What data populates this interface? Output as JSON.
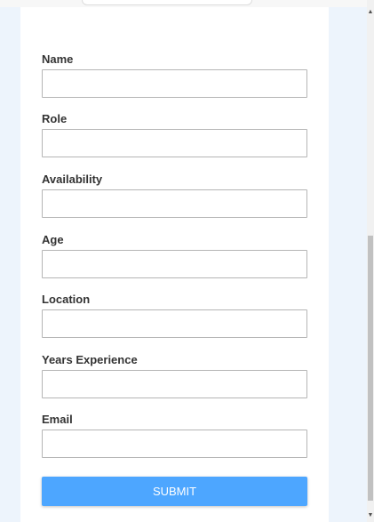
{
  "form": {
    "fields": [
      {
        "label": "Name",
        "value": ""
      },
      {
        "label": "Role",
        "value": ""
      },
      {
        "label": "Availability",
        "value": ""
      },
      {
        "label": "Age",
        "value": ""
      },
      {
        "label": "Location",
        "value": ""
      },
      {
        "label": "Years Experience",
        "value": ""
      },
      {
        "label": "Email",
        "value": ""
      }
    ],
    "submit_label": "SUBMIT"
  },
  "scrollbar": {
    "up_icon": "chevron-up-icon",
    "down_icon": "chevron-down-icon",
    "up_glyph": "▲",
    "down_glyph": "▼",
    "scroll_position_fraction": 0.6
  },
  "colors": {
    "page_background": "#edf4fc",
    "card_background": "#ffffff",
    "submit_button": "#4da6ff",
    "input_border": "#b5b5b5",
    "label_text": "#333333"
  }
}
